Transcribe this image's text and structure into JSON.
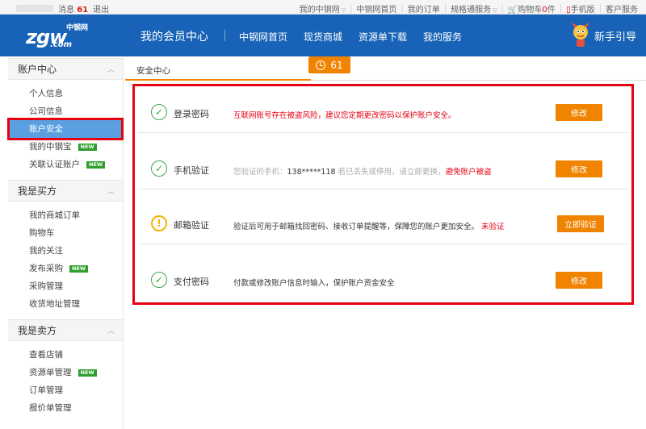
{
  "topbar": {
    "messages_label": "消息",
    "messages_count": "61",
    "logout": "退出",
    "links": [
      {
        "label": "我的中钢网",
        "dropdown": true
      },
      {
        "label": "中钢网首页",
        "dropdown": false
      },
      {
        "label": "我的订单",
        "dropdown": false
      },
      {
        "label": "规格通服务",
        "dropdown": true
      }
    ],
    "cart_label": "购物车",
    "cart_count": "0",
    "cart_unit": "件",
    "mobile": "手机版",
    "service": "客户服务"
  },
  "header": {
    "logo_main": "zgw",
    "logo_com": ".com",
    "logo_cn": "中钢网",
    "title": "我的会员中心",
    "nav": [
      "中钢网首页",
      "现货商城",
      "资源单下载",
      "我的服务"
    ],
    "guide": "新手引导"
  },
  "sidebar": {
    "sections": [
      {
        "title": "账户中心",
        "items": [
          {
            "label": "个人信息",
            "new": false
          },
          {
            "label": "公司信息",
            "new": false
          },
          {
            "label": "账户安全",
            "new": false,
            "active": true
          },
          {
            "label": "我的中钢宝",
            "new": true
          },
          {
            "label": "关联认证账户",
            "new": true
          }
        ]
      },
      {
        "title": "我是买方",
        "items": [
          {
            "label": "我的商城订单",
            "new": false
          },
          {
            "label": "购物车",
            "new": false
          },
          {
            "label": "我的关注",
            "new": false
          },
          {
            "label": "发布采购",
            "new": true
          },
          {
            "label": "采购管理",
            "new": false
          },
          {
            "label": "收货地址管理",
            "new": false
          }
        ]
      },
      {
        "title": "我是卖方",
        "items": [
          {
            "label": "查看店铺",
            "new": false
          },
          {
            "label": "资源单管理",
            "new": true
          },
          {
            "label": "订单管理",
            "new": false
          },
          {
            "label": "报价单管理",
            "new": false
          }
        ]
      }
    ],
    "new_badge": "NEW"
  },
  "main": {
    "title": "安全中心",
    "timer": "61",
    "rows": [
      {
        "name": "登录密码",
        "status": "ok",
        "desc_parts": [
          {
            "text": "互联网账号存在被盗风险，建议您定期更改密码以保护账户安全。",
            "style": "red"
          }
        ],
        "button": "修改"
      },
      {
        "name": "手机验证",
        "status": "ok",
        "desc_parts": [
          {
            "text": "您验证的手机：",
            "style": "grey"
          },
          {
            "text": "138*****118",
            "style": "dark"
          },
          {
            "text": " 若已丢失或停用，请立即更换，",
            "style": "grey"
          },
          {
            "text": "避免账户被盗",
            "style": "red"
          }
        ],
        "button": "修改"
      },
      {
        "name": "邮箱验证",
        "status": "warn",
        "desc_parts": [
          {
            "text": "验证后可用于邮箱找回密码、接收订单提醒等，保障您的账户更加安全。",
            "style": "dark"
          },
          {
            "text": " 未验证",
            "style": "red"
          }
        ],
        "button": "立即验证"
      },
      {
        "name": "支付密码",
        "status": "ok",
        "desc_parts": [
          {
            "text": "付款或修改账户信息时输入，保护账户资金安全",
            "style": "dark"
          }
        ],
        "button": "修改"
      }
    ]
  }
}
